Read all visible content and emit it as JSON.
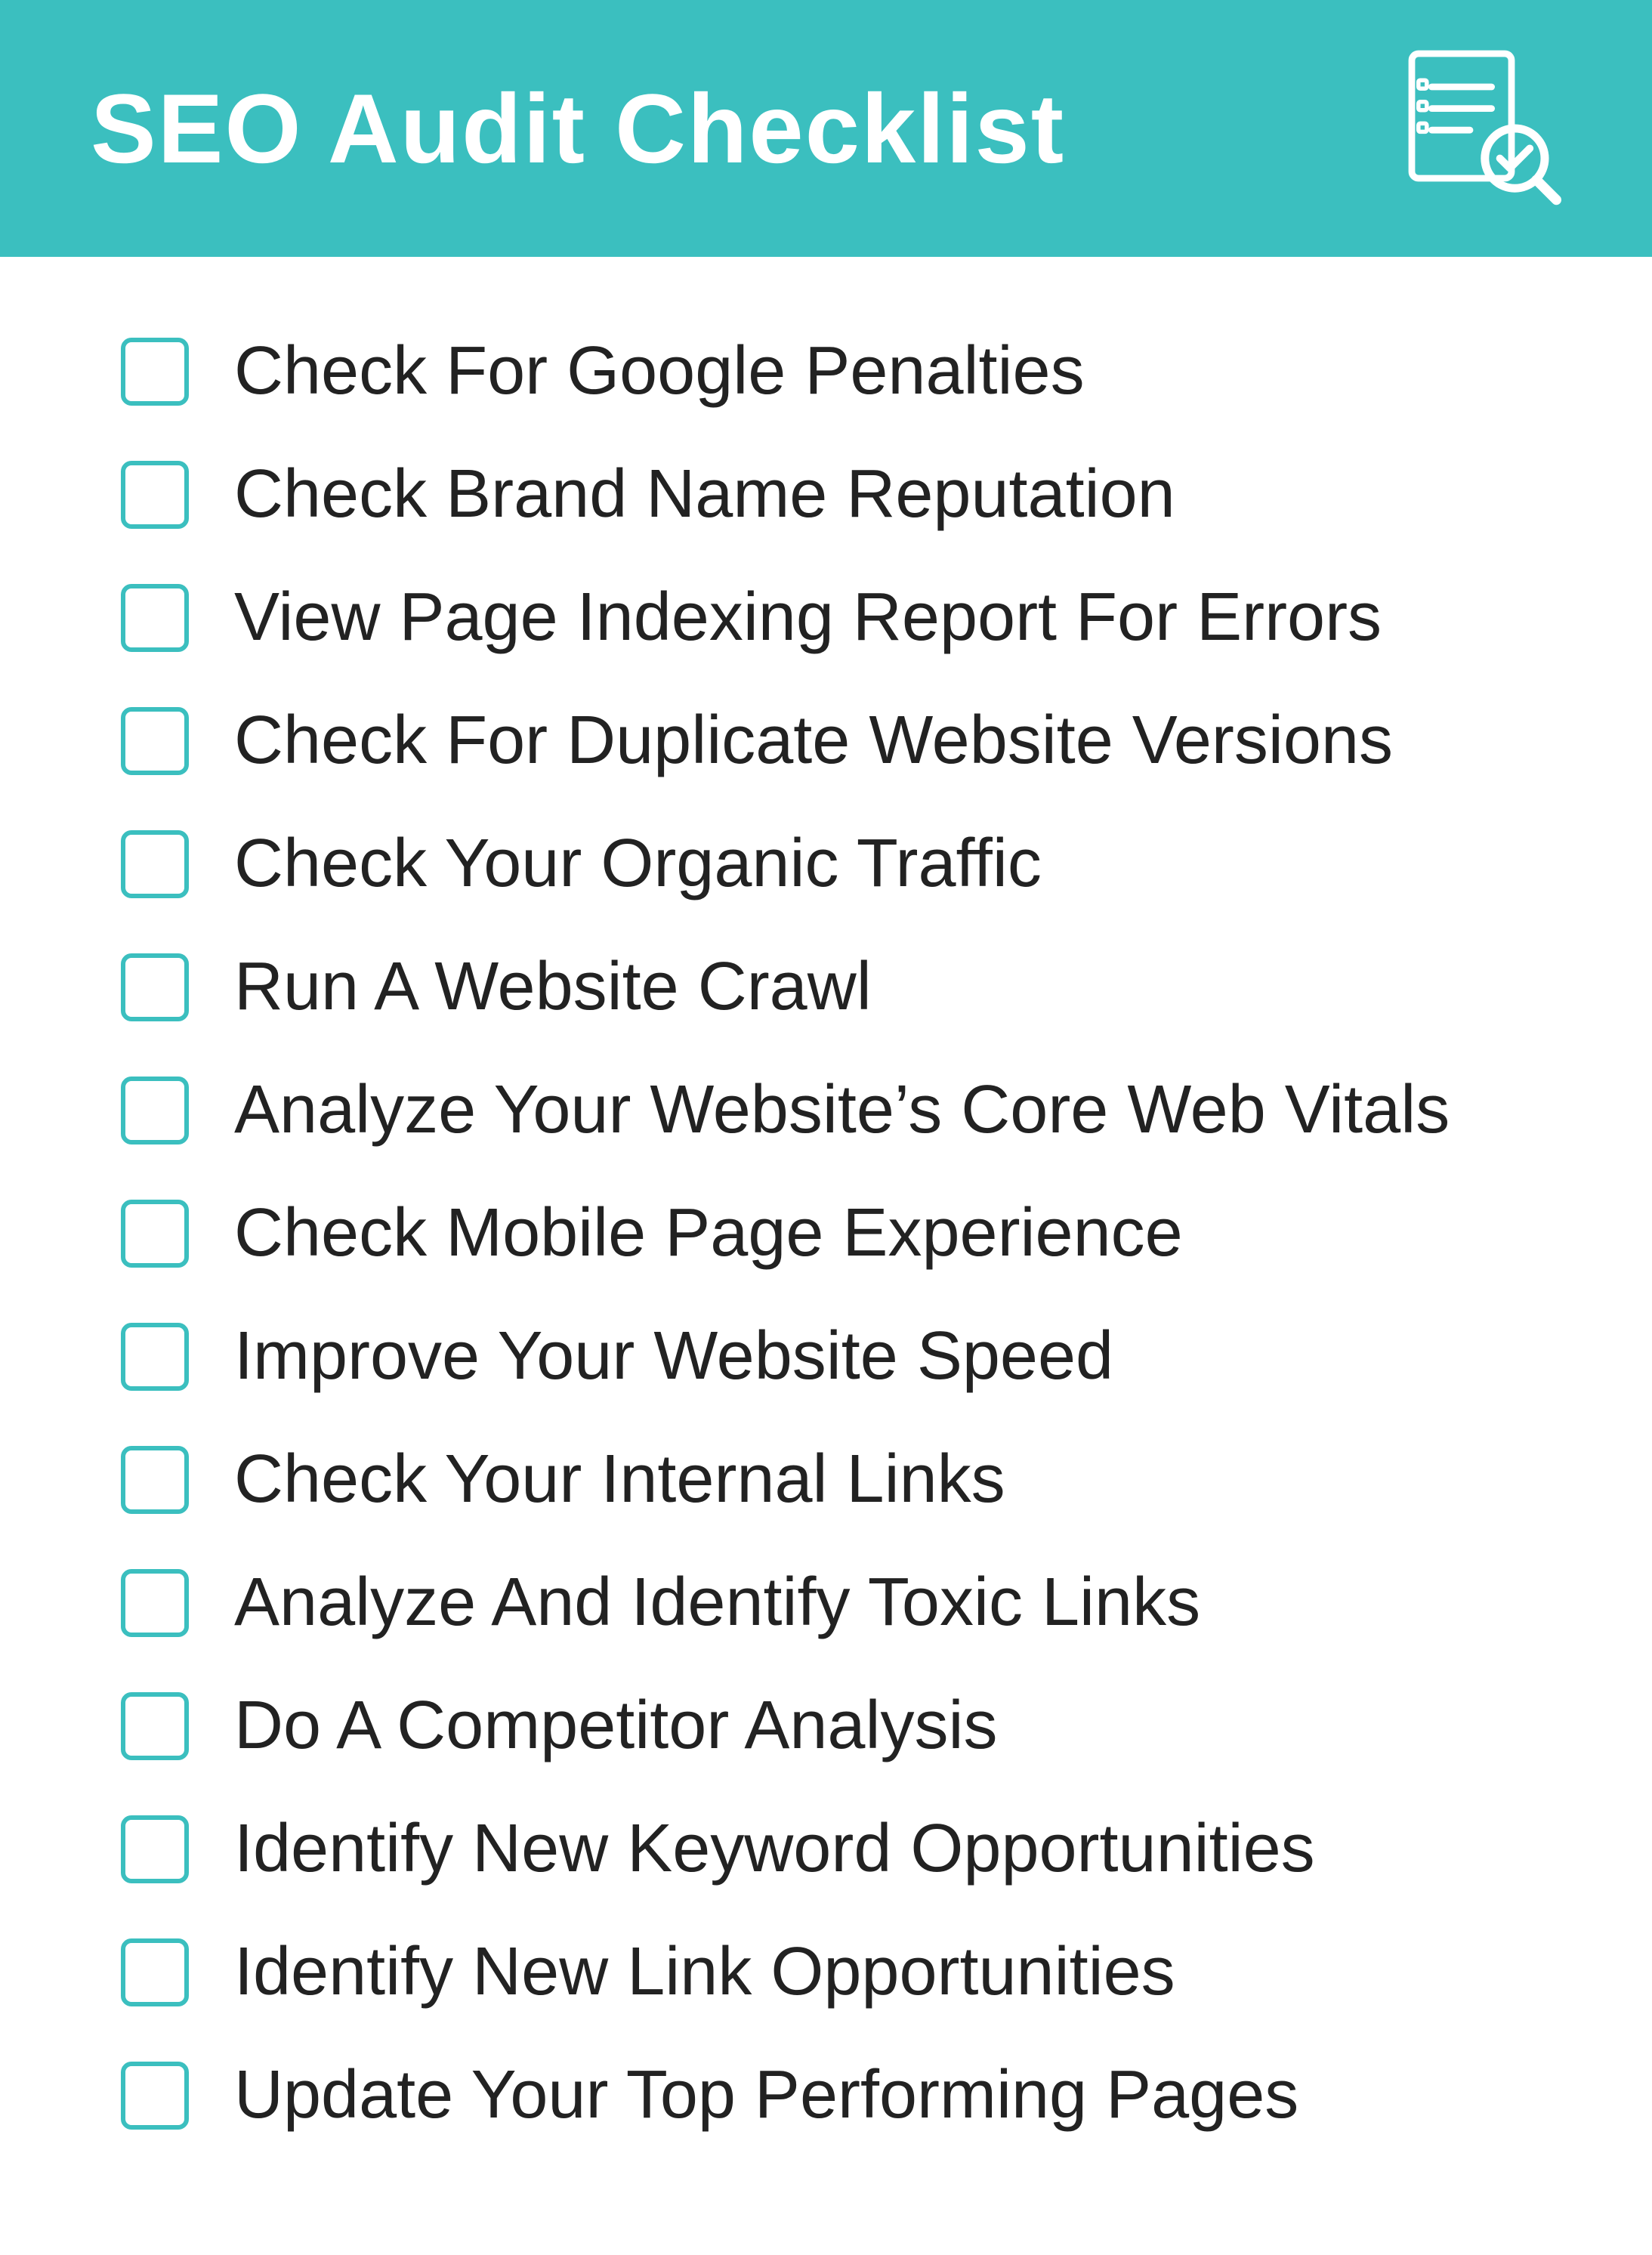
{
  "header": {
    "title": "SEO Audit Checklist"
  },
  "checklist": {
    "items": [
      {
        "id": 1,
        "label": "Check For Google Penalties"
      },
      {
        "id": 2,
        "label": "Check Brand Name Reputation"
      },
      {
        "id": 3,
        "label": "View Page Indexing Report For Errors"
      },
      {
        "id": 4,
        "label": "Check For Duplicate Website Versions"
      },
      {
        "id": 5,
        "label": "Check Your Organic Traffic"
      },
      {
        "id": 6,
        "label": "Run A Website Crawl"
      },
      {
        "id": 7,
        "label": "Analyze Your Website’s Core Web Vitals"
      },
      {
        "id": 8,
        "label": "Check Mobile Page Experience"
      },
      {
        "id": 9,
        "label": "Improve Your Website Speed"
      },
      {
        "id": 10,
        "label": "Check Your Internal Links"
      },
      {
        "id": 11,
        "label": "Analyze And Identify Toxic Links"
      },
      {
        "id": 12,
        "label": "Do A Competitor Analysis"
      },
      {
        "id": 13,
        "label": "Identify New Keyword Opportunities"
      },
      {
        "id": 14,
        "label": "Identify New Link Opportunities"
      },
      {
        "id": 15,
        "label": "Update Your Top Performing Pages"
      }
    ]
  },
  "colors": {
    "teal": "#3bbfbf",
    "white": "#ffffff",
    "dark": "#222222"
  }
}
